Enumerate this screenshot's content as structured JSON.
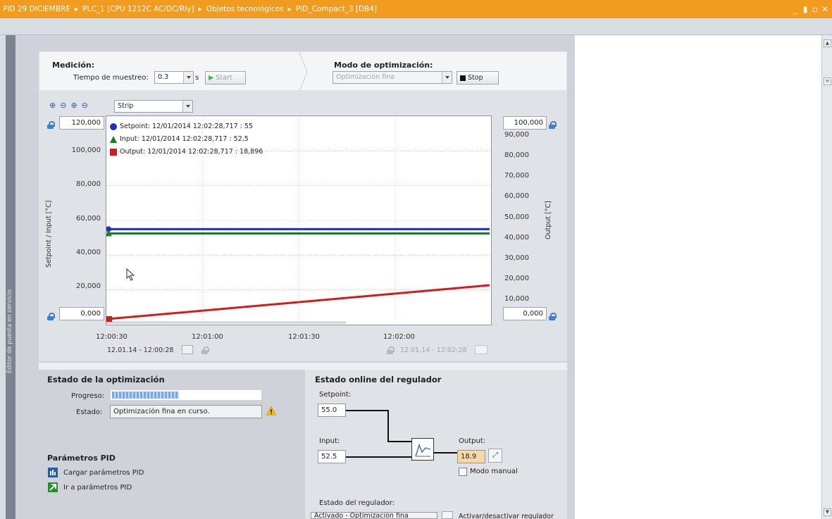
{
  "window": {
    "breadcrumb": [
      "PID 29 DICIEMBRE",
      "PLC_1 [CPU 1212C AC/DC/Rly]",
      "Objetos tecnológicos",
      "PID_Compact_3 [DB4]"
    ],
    "controls": [
      "_",
      "▮",
      "▫",
      "✕"
    ]
  },
  "sidebar": {
    "vertical_text": "Editor de puesta en servicio"
  },
  "measurement": {
    "title": "Medición:",
    "sample_time_label": "Tiempo de muestreo:",
    "sample_time_value": "0.3",
    "unit": "s",
    "start_label": "Start"
  },
  "optimization_mode": {
    "title": "Modo de optimización:",
    "mode_value": "Optimización fina",
    "stop_label": "Stop"
  },
  "chart_toolbar": {
    "display_mode": "Strip"
  },
  "chart": {
    "left_max": "120,000",
    "left_min": "0,000",
    "right_max": "100,000",
    "right_min": "0,000",
    "left_ticks": [
      "100,000",
      "80,000",
      "60,000",
      "40,000",
      "20,000"
    ],
    "right_ticks": [
      "90,000",
      "80,000",
      "70,000",
      "60,000",
      "50,000",
      "40,000",
      "30,000",
      "20,000",
      "10,000"
    ],
    "left_axis_label": "Setpoint / Input  [°C]",
    "right_axis_label": "Output  [°C]",
    "x_ticks": [
      "12:00:30",
      "12:01:00",
      "12:01:30",
      "12:02:00"
    ],
    "start_time": "12.01.14 - 12:00:28",
    "end_time": "12.01.14 - 12:02:28",
    "legend": [
      {
        "label": "Setpoint:  12/01/2014 12:02:28,717 : 55",
        "color": "#1f2fbf"
      },
      {
        "label": "Input:  12/01/2014 12:02:28,717 : 52,5",
        "color": "#1d7a2a"
      },
      {
        "label": "Output:  12/01/2014 12:02:28,717 : 18,896",
        "color": "#d41b1b"
      }
    ]
  },
  "chart_data": {
    "type": "line",
    "x": [
      "12:00:30",
      "12:02:28"
    ],
    "series": [
      {
        "name": "Setpoint",
        "axis": "left",
        "values": [
          55,
          55
        ],
        "color": "#1f2fbf"
      },
      {
        "name": "Input",
        "axis": "left",
        "values": [
          52.5,
          52.5
        ],
        "color": "#1d7a2a"
      },
      {
        "name": "Output",
        "axis": "right",
        "values": [
          2.7,
          18.9
        ],
        "color": "#d41b1b"
      }
    ],
    "ylim_left": [
      0,
      120
    ],
    "ylim_right": [
      0,
      100
    ],
    "xlabel": "",
    "ylabel": "Setpoint / Input  [°C]",
    "ylabel_right": "Output  [°C]",
    "grid": true,
    "legend_position": "top-left"
  },
  "optimization_status": {
    "title": "Estado de la optimización",
    "progress_label": "Progreso:",
    "progress_fraction": 0.45,
    "status_label": "Estado:",
    "status_value": "Optimización fina en curso."
  },
  "pid_params": {
    "title": "Parámetros PID",
    "load_label": "Cargar parámetros PID",
    "goto_label": "Ir a parámetros PID"
  },
  "online_status": {
    "title": "Estado online del regulador",
    "setpoint_label": "Setpoint:",
    "setpoint_value": "55.0",
    "input_label": "Input:",
    "input_value": "52.5",
    "output_label": "Output:",
    "output_value": "18.9",
    "manual_mode_label": "Modo manual",
    "controller_state_label": "Estado del regulador:",
    "controller_state_value": "Activado - Optimización fina",
    "toggle_label": "Activar/desactivar regulador"
  }
}
